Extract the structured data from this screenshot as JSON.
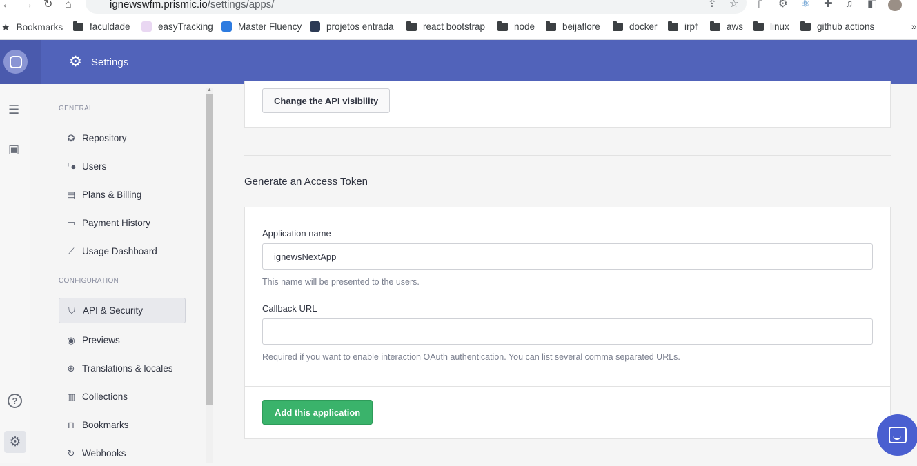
{
  "browser": {
    "url_host": "ignewswfm.prismic.io",
    "url_path": "/settings/apps/",
    "bookmarks": [
      {
        "label": "Bookmarks",
        "type": "star"
      },
      {
        "label": "faculdade",
        "type": "folder"
      },
      {
        "label": "easyTracking",
        "type": "site"
      },
      {
        "label": "Master Fluency",
        "type": "site"
      },
      {
        "label": "projetos entrada",
        "type": "site"
      },
      {
        "label": "react bootstrap",
        "type": "folder"
      },
      {
        "label": "node",
        "type": "folder"
      },
      {
        "label": "beijaflore",
        "type": "folder"
      },
      {
        "label": "docker",
        "type": "folder"
      },
      {
        "label": "irpf",
        "type": "folder"
      },
      {
        "label": "aws",
        "type": "folder"
      },
      {
        "label": "linux",
        "type": "folder"
      },
      {
        "label": "github actions",
        "type": "folder"
      }
    ],
    "more": "»"
  },
  "header": {
    "title": "Settings"
  },
  "nav": {
    "general_label": "GENERAL",
    "configuration_label": "CONFIGURATION",
    "general_items": [
      {
        "label": "Repository",
        "icon": "repository-icon"
      },
      {
        "label": "Users",
        "icon": "user-add-icon"
      },
      {
        "label": "Plans & Billing",
        "icon": "wallet-icon"
      },
      {
        "label": "Payment History",
        "icon": "card-icon"
      },
      {
        "label": "Usage Dashboard",
        "icon": "trend-icon"
      }
    ],
    "config_items": [
      {
        "label": "API & Security",
        "icon": "shield-icon",
        "active": true
      },
      {
        "label": "Previews",
        "icon": "eye-icon"
      },
      {
        "label": "Translations & locales",
        "icon": "globe-icon"
      },
      {
        "label": "Collections",
        "icon": "collections-icon"
      },
      {
        "label": "Bookmarks",
        "icon": "bookmark-icon"
      },
      {
        "label": "Webhooks",
        "icon": "sync-icon"
      }
    ]
  },
  "main": {
    "change_visibility_label": "Change the API visibility",
    "section_title": "Generate an Access Token",
    "app_name_label": "Application name",
    "app_name_value": "ignewsNextApp",
    "app_name_help": "This name will be presented to the users.",
    "callback_label": "Callback URL",
    "callback_value": "",
    "callback_help": "Required if you want to enable interaction OAuth authentication. You can list several comma separated URLs.",
    "submit_label": "Add this application"
  },
  "colors": {
    "header_bg": "#5163ba",
    "primary_button": "#3ab36b",
    "chat_bubble": "#4a5fd0"
  }
}
